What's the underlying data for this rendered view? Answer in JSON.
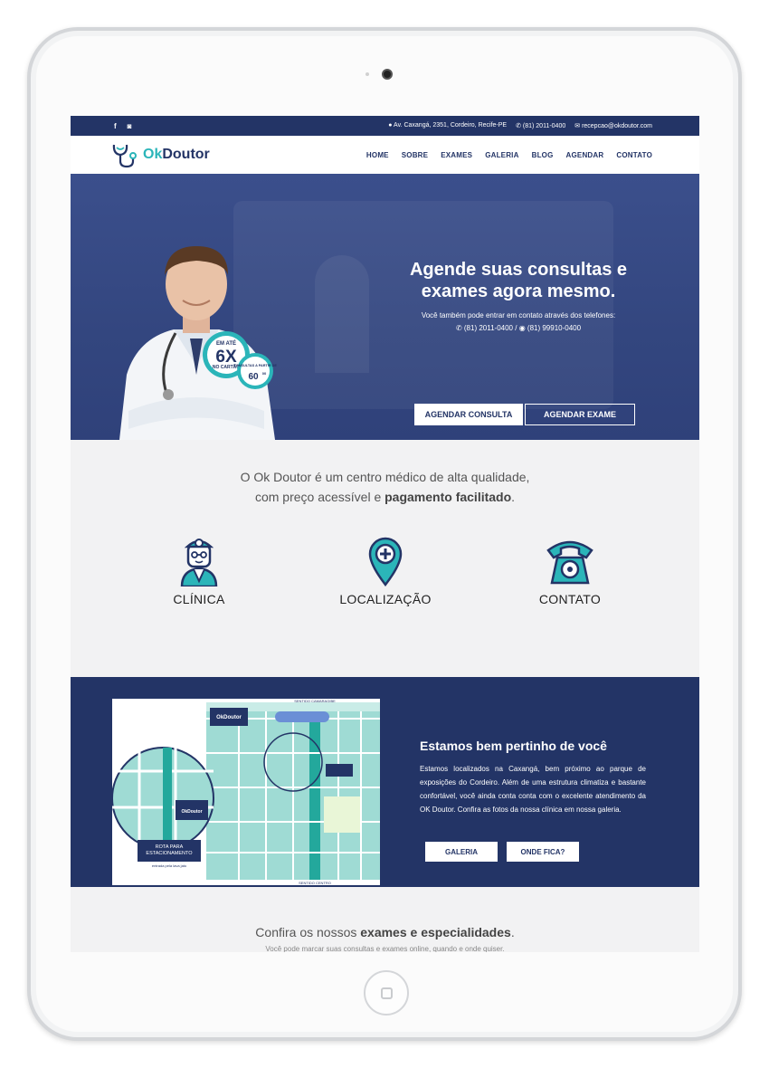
{
  "topbar": {
    "social": [
      {
        "icon": "facebook-icon",
        "glyph": "f"
      },
      {
        "icon": "instagram-icon",
        "glyph": "◙"
      }
    ],
    "address": "Av. Caxangá, 2351, Cordeiro, Recife-PE",
    "phone": "(81) 2011-0400",
    "email": "recepcao@okdoutor.com"
  },
  "header": {
    "logo_ok": "Ok",
    "logo_rest": "Doutor",
    "nav": [
      "HOME",
      "SOBRE",
      "EXAMES",
      "GALERIA",
      "BLOG",
      "AGENDAR",
      "CONTATO"
    ]
  },
  "hero": {
    "title_line1": "Agende suas consultas e",
    "title_line2": "exames agora mesmo.",
    "subtitle": "Você também pode entrar em contato através dos telefones:",
    "phone1": "(81) 2011-0400",
    "separator": "/",
    "phone2": "(81) 99910-0400",
    "btn_consulta": "AGENDAR CONSULTA",
    "btn_exame": "AGENDAR EXAME",
    "badge_top": "EM ATÉ",
    "badge_big": "6X",
    "badge_bottom": "NO CARTÃO",
    "badge2_text": "CONSULTAS A PARTIR DE",
    "badge2_price": "60",
    "badge2_cents": "00"
  },
  "intro": {
    "line1": "O Ok Doutor é um centro médico de alta qualidade,",
    "line2_pre": "com preço acessível e ",
    "line2_bold": "pagamento facilitado",
    "line2_end": "."
  },
  "features": [
    {
      "label": "CLÍNICA",
      "icon": "doctor-icon"
    },
    {
      "label": "LOCALIZAÇÃO",
      "icon": "location-pin-icon"
    },
    {
      "label": "CONTATO",
      "icon": "telephone-icon"
    }
  ],
  "location": {
    "title": "Estamos bem pertinho de você",
    "text": "Estamos localizados na Caxangá, bem próximo ao parque de exposições do Cordeiro. Além de uma estrutura climatiza e bastante confortável, você ainda conta conta com o excelente atendimento da OK Doutor. Confira as fotos da nossa clínica em nossa galeria.",
    "btn_galeria": "GALERIA",
    "btn_onde": "ONDE FICA?",
    "map_top": "SENTIDO CAMARAGIBE",
    "map_bottom": "SENTIDO CENTRO",
    "map_route1": "ROTA PARA",
    "map_route2": "ESTACIONAMENTO",
    "map_route3": "entrada pela lava jato",
    "map_logo": "OkDoutor"
  },
  "exams": {
    "title_pre": "Confira os nossos ",
    "title_bold": "exames e especialidades",
    "title_end": ".",
    "subtitle": "Você pode marcar suas consultas e exames online, quando e onde quiser."
  },
  "colors": {
    "navy": "#233466",
    "teal": "#2bb5b9",
    "hero": "#33467f"
  }
}
